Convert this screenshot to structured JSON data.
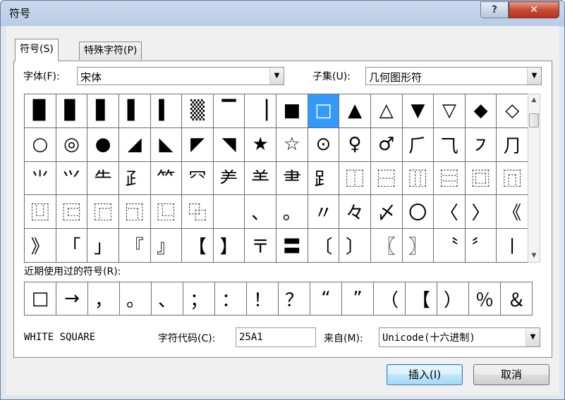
{
  "window": {
    "title": "符号",
    "help_label": "?",
    "close_label": "✕"
  },
  "tabs": [
    {
      "label": "符号(S)"
    },
    {
      "label": "特殊字符(P)"
    }
  ],
  "font_label": "字体(F):",
  "font_value": "宋体",
  "subset_label": "子集(U):",
  "subset_value": "几何图形符",
  "symbol_grid": [
    [
      "▉",
      "▊",
      "▋",
      "▌",
      "▍",
      "▒",
      "▔",
      "▕",
      "■",
      "□",
      "▲",
      "△",
      "▼",
      "▽",
      "◆",
      "◇"
    ],
    [
      "○",
      "◎",
      "●",
      "◢",
      "◣",
      "◤",
      "◥",
      "★",
      "☆",
      "⊙",
      "♀",
      "♂",
      "⺁",
      "⺄",
      "㇇",
      "⺆"
    ],
    [
      "⺌",
      "⺍",
      "⺧",
      "⺪",
      "⺮",
      "⺳",
      "⺶",
      "⺷",
      "⺻",
      "⻊",
      "⿰",
      "⿱",
      "⿲",
      "⿳",
      "⿴",
      "⿵"
    ],
    [
      "⿶",
      "⿷",
      "⿸",
      "⿹",
      "⿺",
      "⿻",
      "　",
      "、",
      "。",
      "〃",
      "々",
      "〆",
      "〇",
      "〈",
      "〉",
      "《"
    ],
    [
      "》",
      "「",
      "」",
      "『",
      "』",
      "【",
      "】",
      "〒",
      "〓",
      "〔",
      "〕",
      "〖",
      "〗",
      "〝",
      "〞",
      "〡"
    ]
  ],
  "selected_symbol": "□",
  "recent_label": "近期使用过的符号(R):",
  "recent_symbols": [
    "□",
    "→",
    "，",
    "。",
    "、",
    "；",
    "：",
    "！",
    "？",
    "“",
    "”",
    "（",
    "【",
    "）",
    "％",
    "＆"
  ],
  "char_name": "WHITE SQUARE",
  "char_code_label": "字符代码(C):",
  "char_code_value": "25A1",
  "from_label": "来自(M):",
  "from_value": "Unicode(十六进制)",
  "buttons": {
    "insert": "插入(I)",
    "cancel": "取消"
  },
  "colors": {
    "selection": "#3399ff",
    "title_bar": "#b9cce6",
    "close_button": "#c64c36"
  }
}
